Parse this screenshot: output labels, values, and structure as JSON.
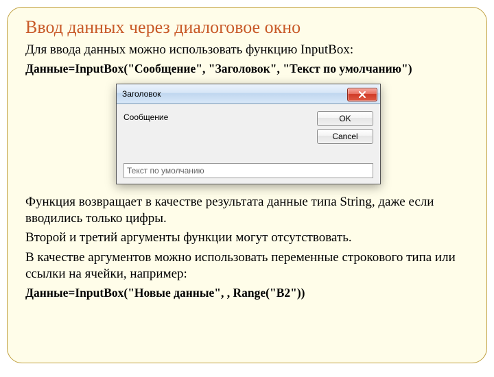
{
  "title": "Ввод данных через диалоговое окно",
  "p1": "Для ввода данных можно использовать функцию InputBox:",
  "code1": "Данные=InputBox(\"Сообщение\", \"Заголовок\", \"Текст по умолчанию\")",
  "dialog": {
    "title": "Заголовок",
    "message": "Сообщение",
    "ok": "OK",
    "cancel": "Cancel",
    "input_value": "Текст по умолчанию"
  },
  "p2": "Функция возвращает в качестве результата данные типа String, даже если вводились только цифры.",
  "p3": "Второй и третий аргументы функции могут отсутствовать.",
  "p4": "В качестве аргументов можно использовать переменные строкового типа или ссылки на ячейки, например:",
  "code2": "Данные=InputBox(\"Новые данные\", , Range(\"B2\"))"
}
